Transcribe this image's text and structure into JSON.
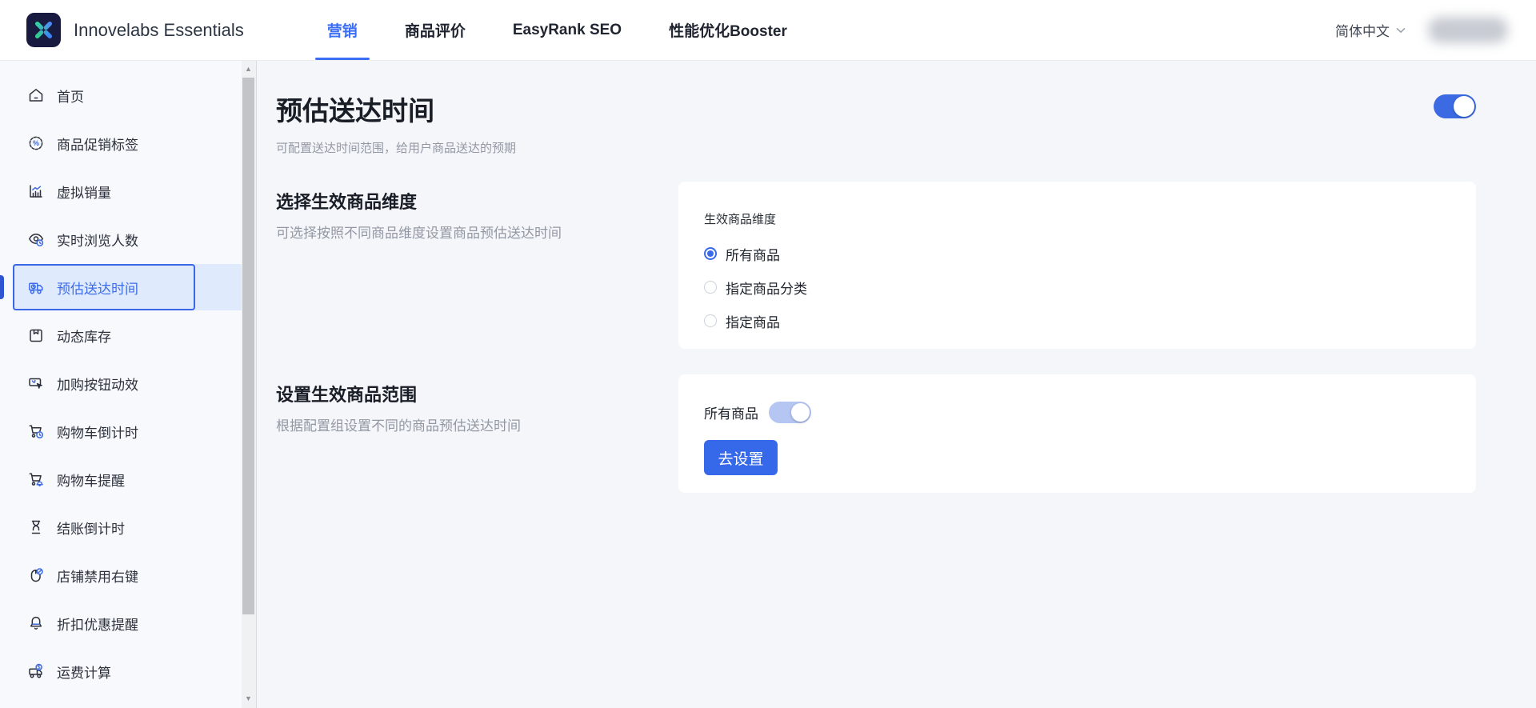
{
  "brand": {
    "name": "Innovelabs Essentials",
    "logo_icon": "x-mark-logo-icon"
  },
  "header": {
    "nav": [
      {
        "id": "marketing",
        "label": "营销",
        "active": true
      },
      {
        "id": "product-reviews",
        "label": "商品评价",
        "active": false
      },
      {
        "id": "easyrank-seo",
        "label": "EasyRank SEO",
        "active": false
      },
      {
        "id": "performance-booster",
        "label": "性能优化Booster",
        "active": false
      }
    ],
    "language": "简体中文",
    "language_chevron_icon": "chevron-down-icon",
    "user_account": "blurred"
  },
  "sidebar": {
    "items": [
      {
        "id": "home",
        "icon": "home-icon",
        "label": "首页",
        "active": false
      },
      {
        "id": "promo-labels",
        "icon": "promo-badge-icon",
        "label": "商品促销标签",
        "active": false
      },
      {
        "id": "virtual-sales",
        "icon": "sales-chart-icon",
        "label": "虚拟销量",
        "active": false
      },
      {
        "id": "live-viewers",
        "icon": "eye-clock-icon",
        "label": "实时浏览人数",
        "active": false
      },
      {
        "id": "delivery-time",
        "icon": "delivery-truck-icon",
        "label": "预估送达时间",
        "active": true
      },
      {
        "id": "dynamic-stock",
        "icon": "package-icon",
        "label": "动态库存",
        "active": false
      },
      {
        "id": "add-to-cart-animation",
        "icon": "button-cursor-icon",
        "label": "加购按钮动效",
        "active": false
      },
      {
        "id": "cart-countdown",
        "icon": "cart-clock-icon",
        "label": "购物车倒计时",
        "active": false
      },
      {
        "id": "cart-reminder",
        "icon": "cart-bell-icon",
        "label": "购物车提醒",
        "active": false
      },
      {
        "id": "checkout-countdown",
        "icon": "hourglass-icon",
        "label": "结账倒计时",
        "active": false
      },
      {
        "id": "disable-right-click",
        "icon": "mouse-block-icon",
        "label": "店铺禁用右键",
        "active": false
      },
      {
        "id": "discount-reminder",
        "icon": "bell-icon",
        "label": "折扣优惠提醒",
        "active": false
      },
      {
        "id": "shipping-calc",
        "icon": "truck-dollar-icon",
        "label": "运费计算",
        "active": false
      }
    ],
    "scrollbar": {
      "up_arrow": "▲",
      "down_arrow": "▼"
    }
  },
  "page": {
    "title": "预估送达时间",
    "subtitle": "可配置送达时间范围，给用户商品送达的预期",
    "master_toggle_on": true,
    "sections": [
      {
        "heading": "选择生效商品维度",
        "description": "可选择按照不同商品维度设置商品预估送达时间",
        "card": {
          "label": "生效商品维度",
          "options": [
            {
              "label": "所有商品",
              "selected": true
            },
            {
              "label": "指定商品分类",
              "selected": false
            },
            {
              "label": "指定商品",
              "selected": false
            }
          ]
        }
      },
      {
        "heading": "设置生效商品范围",
        "description": "根据配置组设置不同的商品预估送达时间",
        "card": {
          "toggle_label": "所有商品",
          "toggle_on": true,
          "toggle_disabled_style": true,
          "button_label": "去设置"
        }
      }
    ]
  },
  "colors": {
    "nav_active_blue": "#3a6ef5",
    "sidebar_active_text": "#3d6cea",
    "sidebar_active_bg": "#dfeafc",
    "sidebar_active_border": "#3a66e8",
    "radio_blue": "#3a6ae8",
    "button_blue": "#3668ea",
    "toggle_on_blue": "#3b6ae3",
    "toggle_soft_blue": "#b5c6f3",
    "logo_bg": "#191a40"
  }
}
